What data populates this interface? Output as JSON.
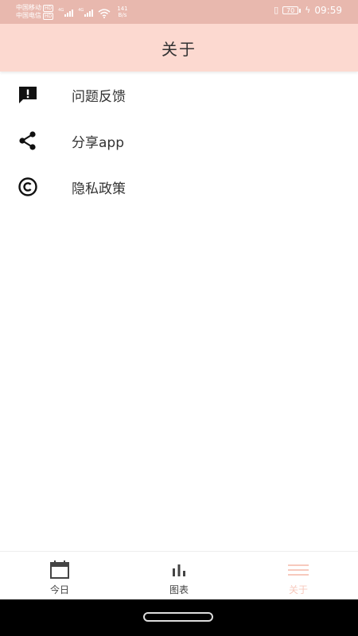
{
  "status_bar": {
    "carrier_1": "中国移动",
    "carrier_2": "中国电信",
    "hd_badge": "HD",
    "net_type": "4G",
    "speed_value": "141",
    "speed_unit": "B/s",
    "battery": "70",
    "time": "09:59",
    "charging_glyph": "ϟ",
    "vibrate_glyph": "▯"
  },
  "header": {
    "title": "关于"
  },
  "menu": {
    "items": [
      {
        "label": "问题反馈",
        "icon": "feedback-icon"
      },
      {
        "label": "分享app",
        "icon": "share-icon"
      },
      {
        "label": "隐私政策",
        "icon": "copyright-icon"
      }
    ]
  },
  "bottom_nav": {
    "items": [
      {
        "label": "今日",
        "icon": "calendar-icon",
        "active": false
      },
      {
        "label": "图表",
        "icon": "bar-chart-icon",
        "active": false
      },
      {
        "label": "关于",
        "icon": "menu-icon",
        "active": true
      }
    ]
  },
  "colors": {
    "header_bg": "#fcd9d0",
    "status_bg": "#e8b8ae",
    "active_tab": "#f7c9bd"
  }
}
